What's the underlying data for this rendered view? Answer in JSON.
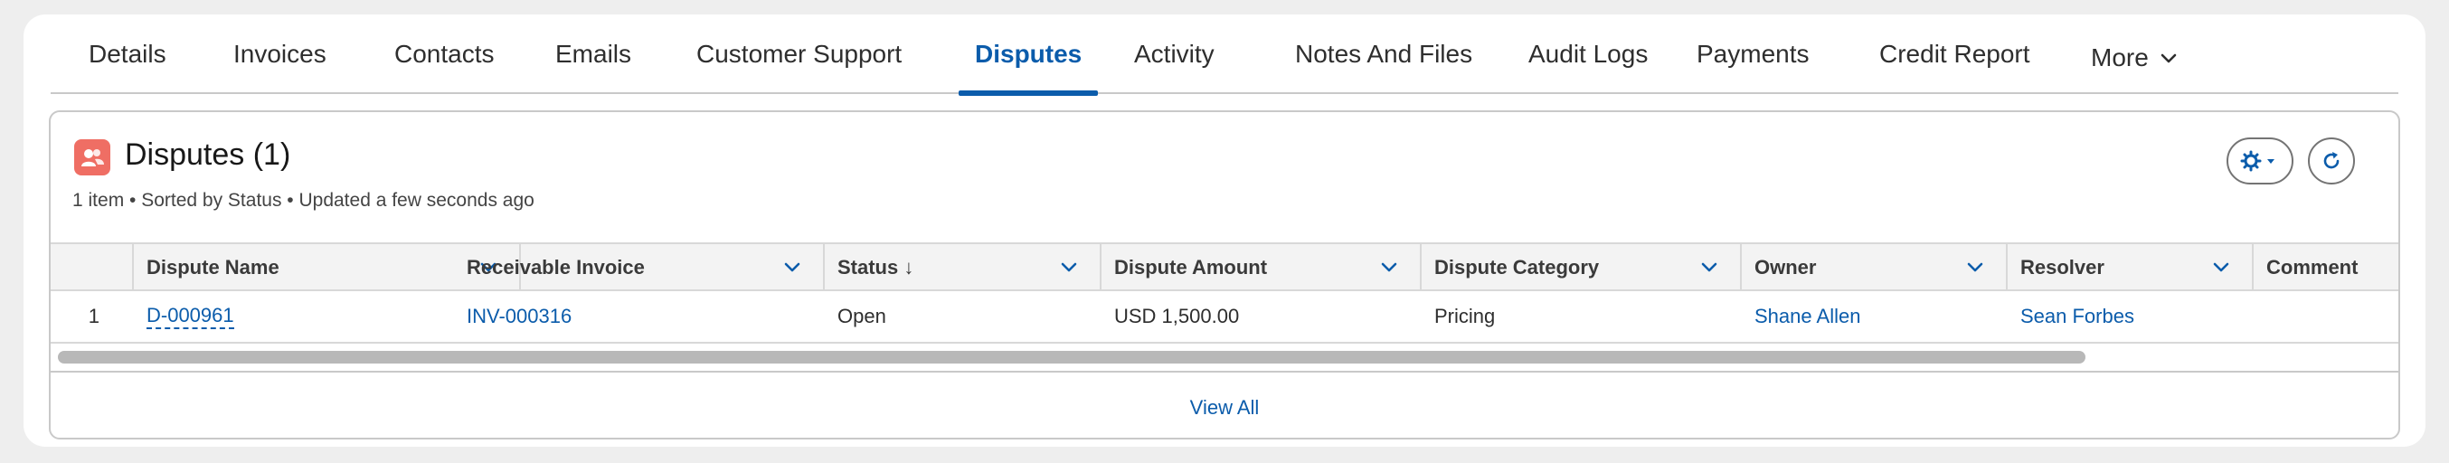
{
  "tabs": [
    {
      "label": "Details"
    },
    {
      "label": "Invoices"
    },
    {
      "label": "Contacts"
    },
    {
      "label": "Emails"
    },
    {
      "label": "Customer Support"
    },
    {
      "label": "Disputes",
      "active": true
    },
    {
      "label": "Activity"
    },
    {
      "label": "Notes And Files"
    },
    {
      "label": "Audit Logs"
    },
    {
      "label": "Payments"
    },
    {
      "label": "Credit Report"
    },
    {
      "label": "More"
    }
  ],
  "card": {
    "title": "Disputes (1)",
    "meta": "1 item • Sorted by Status • Updated a few seconds ago",
    "icon": "disputes-icon",
    "icon_color": "#ef6e64",
    "actions": {
      "settings_icon": "gear-icon",
      "refresh_icon": "refresh-icon"
    },
    "view_all": "View All"
  },
  "table": {
    "columns": [
      {
        "label": "Dispute Name"
      },
      {
        "label": "Receivable Invoice"
      },
      {
        "label": "Status ↓"
      },
      {
        "label": "Dispute Amount"
      },
      {
        "label": "Dispute Category"
      },
      {
        "label": "Owner"
      },
      {
        "label": "Resolver"
      },
      {
        "label": "Comment"
      }
    ],
    "rows": [
      {
        "num": "1",
        "dispute_name": "D-000961",
        "receivable_invoice": "INV-000316",
        "status": "Open",
        "dispute_amount": "USD 1,500.00",
        "dispute_category": "Pricing",
        "owner": "Shane Allen",
        "resolver": "Sean Forbes",
        "comment": ""
      }
    ]
  },
  "colors": {
    "accent": "#0b5cab",
    "border": "#c9c9c9",
    "header_bg": "#f3f3f3"
  }
}
